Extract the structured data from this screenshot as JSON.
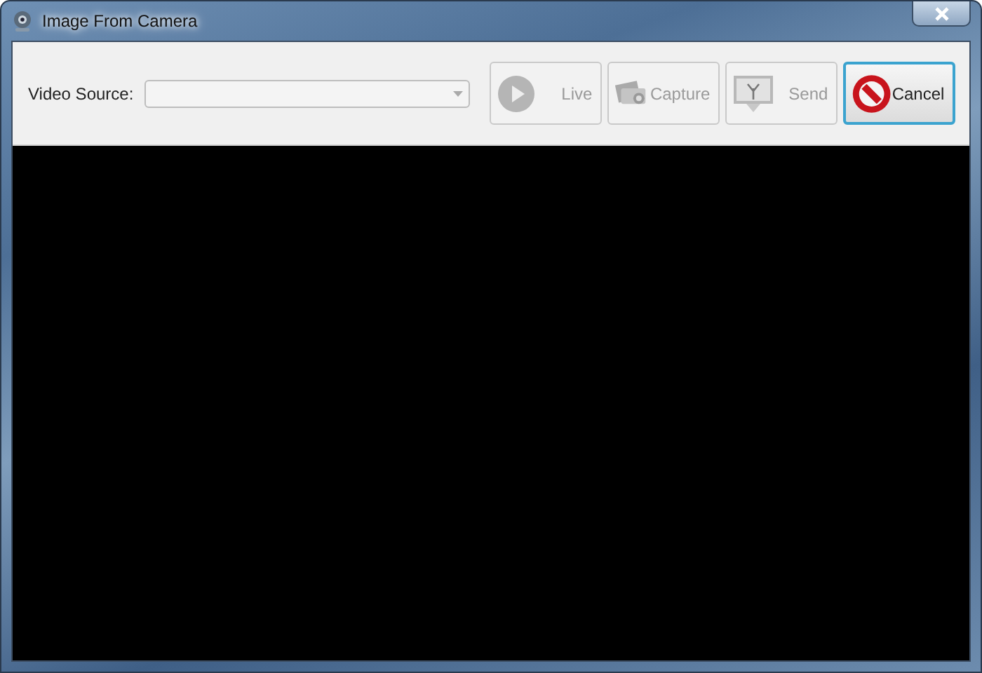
{
  "window": {
    "title": "Image From Camera"
  },
  "toolbar": {
    "video_source": {
      "label": "Video Source:",
      "disabled": true
    },
    "buttons": [
      {
        "kind": "play",
        "label": "Live",
        "disabled": true,
        "focused": false
      },
      {
        "kind": "camera",
        "label": "Capture",
        "disabled": true,
        "focused": false
      },
      {
        "kind": "picture",
        "label": "Send",
        "disabled": true,
        "focused": false
      },
      {
        "kind": "cancel",
        "label": "Cancel",
        "disabled": false,
        "focused": true
      }
    ]
  }
}
